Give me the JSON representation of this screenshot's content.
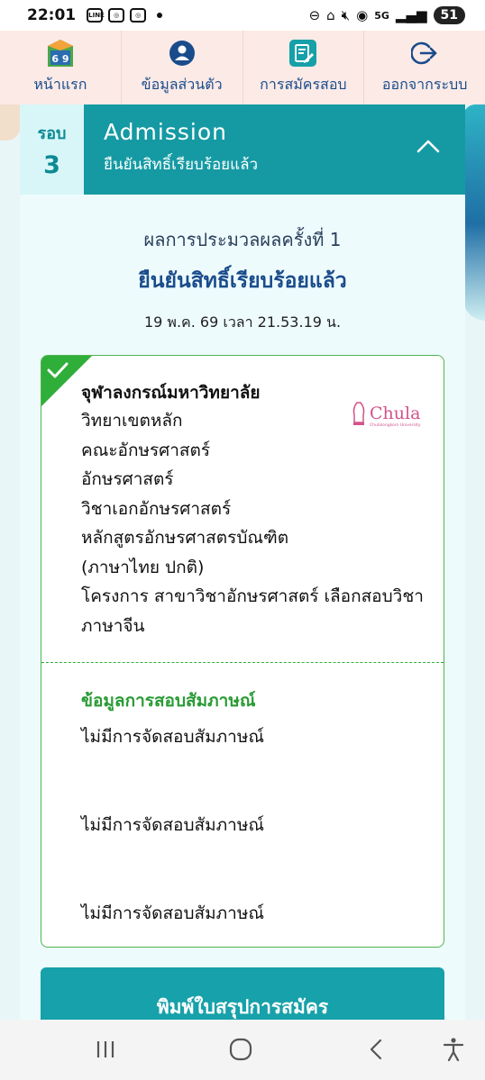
{
  "status_bar": {
    "time": "22:01",
    "network": "5G",
    "battery": "51"
  },
  "top_nav": [
    {
      "label": "หน้าแรก",
      "icon": "home-69-icon"
    },
    {
      "label": "ข้อมูลส่วนตัว",
      "icon": "user-icon"
    },
    {
      "label": "การสมัครสอบ",
      "icon": "application-edit-icon"
    },
    {
      "label": "ออกจากระบบ",
      "icon": "logout-icon"
    }
  ],
  "round": {
    "label": "รอบ",
    "number": "3",
    "title": "Admission",
    "subtitle": "ยืนยันสิทธิ์เรียบร้อยแล้ว"
  },
  "result": {
    "title": "ผลการประมวลผลครั้งที่ 1",
    "status": "ยืนยันสิทธิ์เรียบร้อยแล้ว",
    "datetime": "19 พ.ค. 69 เวลา 21.53.19 น."
  },
  "program": {
    "university": "จุฬาลงกรณ์มหาวิทยาลัย",
    "lines": [
      "วิทยาเขตหลัก",
      "คณะอักษรศาสตร์",
      "อักษรศาสตร์",
      "วิชาเอกอักษรศาสตร์",
      "หลักสูตรอักษรศาสตรบัณฑิต",
      "(ภาษาไทย ปกติ)",
      "โครงการ สาขาวิชาอักษรศาสตร์ เลือกสอบวิชา",
      "ภาษาจีน"
    ],
    "logo_text": "Chula",
    "logo_subtext": "Chulalongkorn University"
  },
  "interview": {
    "title": "ข้อมูลการสอบสัมภาษณ์",
    "items": [
      "ไม่มีการจัดสอบสัมภาษณ์",
      "ไม่มีการจัดสอบสัมภาษณ์",
      "ไม่มีการจัดสอบสัมภาษณ์"
    ]
  },
  "print_button": {
    "label": "พิมพ์ใบสรุปการสมัคร"
  },
  "colors": {
    "teal": "#159aa3",
    "navy": "#1a4c8c",
    "green": "#2fae39",
    "nav_bg": "#fbeae6",
    "chula_pink": "#d2538a"
  }
}
